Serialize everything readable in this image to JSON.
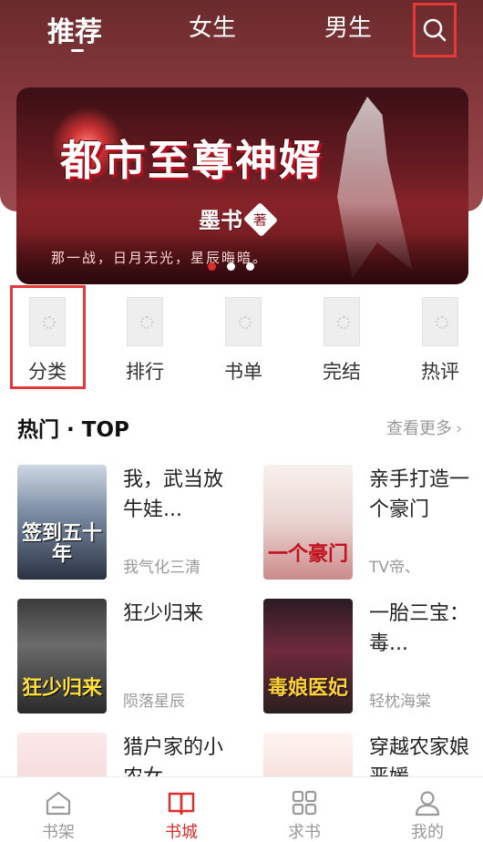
{
  "header": {
    "tabs": [
      {
        "label": "推荐",
        "active": true
      },
      {
        "label": "女生",
        "active": false
      },
      {
        "label": "男生",
        "active": false
      }
    ],
    "search_icon": "search-icon"
  },
  "banner": {
    "title": "都市至尊神婿",
    "author": "墨书",
    "author_suffix": "著",
    "tagline": "那一战，日月无光，星辰晦暗。",
    "dots_count": 3,
    "active_dot": 0
  },
  "categories": [
    {
      "label": "分类",
      "icon": "image-placeholder-icon"
    },
    {
      "label": "排行",
      "icon": "image-placeholder-icon"
    },
    {
      "label": "书单",
      "icon": "image-placeholder-icon"
    },
    {
      "label": "完结",
      "icon": "image-placeholder-icon"
    },
    {
      "label": "热评",
      "icon": "image-placeholder-icon"
    }
  ],
  "section": {
    "title": "热门 · TOP",
    "more": "查看更多",
    "chevron_icon": "chevron-right-icon"
  },
  "books": [
    {
      "title": "我，武当放牛娃...",
      "author": "我气化三清",
      "cover_text": "签到五十年"
    },
    {
      "title": "亲手打造一个豪门",
      "author": "TV帝、",
      "cover_text": "一个豪门"
    },
    {
      "title": "狂少归来",
      "author": "陨落星辰",
      "cover_text": "狂少归来"
    },
    {
      "title": "一胎三宝：毒...",
      "author": "轻枕海棠",
      "cover_text": "毒娘医妃"
    },
    {
      "title": "猎户家的小农女",
      "author": "",
      "cover_text": ""
    },
    {
      "title": "穿越农家娘恶媛",
      "author": "",
      "cover_text": ""
    }
  ],
  "bottom_nav": [
    {
      "label": "书架",
      "icon": "bookshelf-icon",
      "active": false
    },
    {
      "label": "书城",
      "icon": "book-open-icon",
      "active": true
    },
    {
      "label": "求书",
      "icon": "grid-icon",
      "active": false
    },
    {
      "label": "我的",
      "icon": "user-icon",
      "active": false
    }
  ],
  "colors": {
    "accent": "#e02b2b",
    "header_bg": "#7a3034",
    "highlight_box": "#e53939"
  }
}
